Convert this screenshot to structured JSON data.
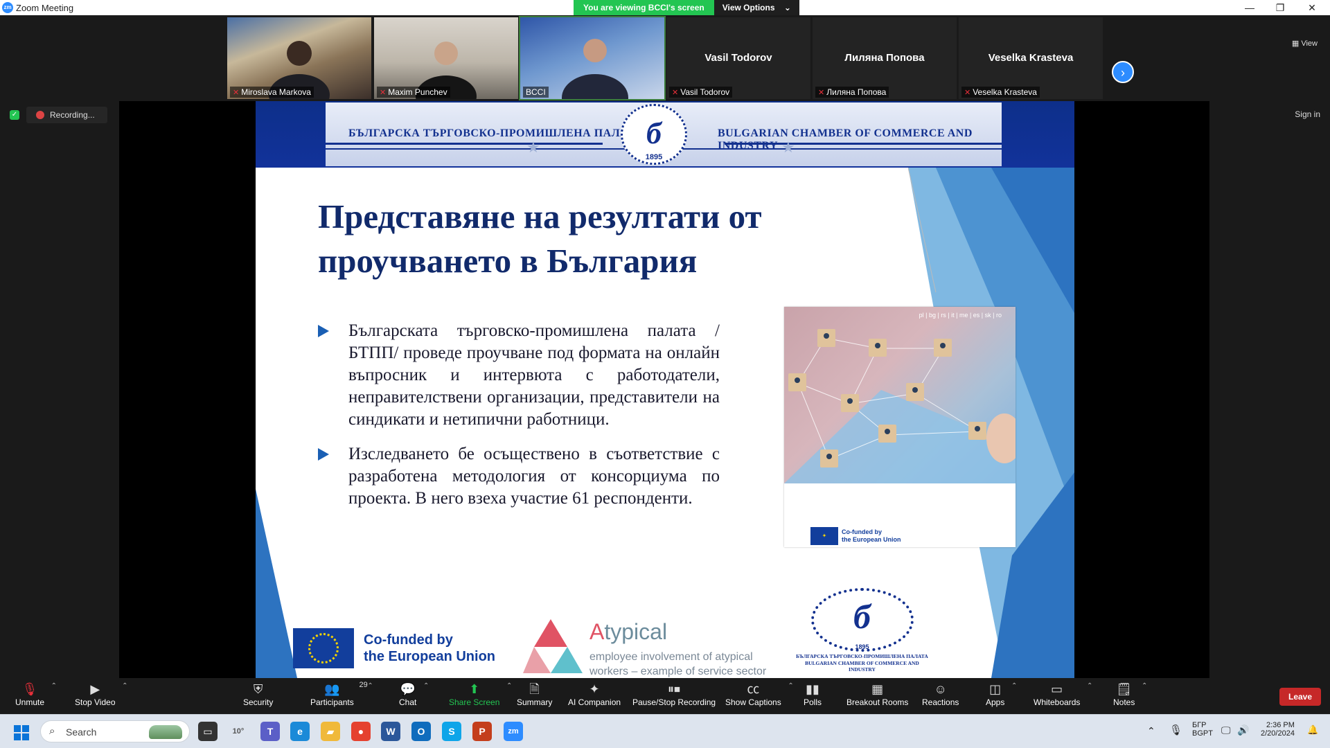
{
  "window": {
    "title": "Zoom Meeting",
    "logo_text": "zm",
    "minimize": "—",
    "maximize": "❐",
    "close": "✕"
  },
  "viewing_banner": {
    "text": "You are viewing BCCI's screen",
    "options_label": "View Options",
    "options_caret": "⌄"
  },
  "gallery": {
    "participants": [
      {
        "name": "Miroslava Markova",
        "has_video": true
      },
      {
        "name": "Maxim Punchev",
        "has_video": true
      },
      {
        "name": "BCCI",
        "has_video": true,
        "active": true
      },
      {
        "name": "Vasil Todorov",
        "has_video": false
      },
      {
        "name": "Лиляна Попова",
        "has_video": false
      },
      {
        "name": "Veselka Krasteva",
        "has_video": false
      }
    ],
    "next_arrow": "›",
    "view_label": "View"
  },
  "status": {
    "recording_label": "Recording...",
    "pause_glyph": "❚❚",
    "sign_in": "Sign in"
  },
  "slide": {
    "header_left": "БЪЛГАРСКА ТЪРГОВСКО-ПРОМИШЛЕНА ПАЛАТА",
    "header_right": "BULGARIAN CHAMBER OF COMMERCE AND INDUSTRY",
    "emblem_letter": "б",
    "emblem_year": "1895",
    "title": "Представяне на резултати от проучването в България",
    "bullets": [
      "Българската търговско-промишлена палата /БТПП/ проведе проучване под формата на онлайн въпросник и интервюта с работодатели, неправителствени организации, представители на синдикати и нетипични работници.",
      "Изследването бе осъществено в съответствие с разработена методология от консорциума по проекта. В него взеха участие 61 респонденти."
    ],
    "photo_langs": "pl | bg | rs | it | me | es | sk | ro",
    "photo_cofund_1": "Co-funded by",
    "photo_cofund_2": "the European Union",
    "footer_cofund_1": "Co-funded by",
    "footer_cofund_2": "the European Union",
    "atypical_A": "A",
    "atypical_rest": "typical",
    "atypical_sub_1": "employee involvement of atypical",
    "atypical_sub_2": "workers – example of service sector",
    "bcci_letter": "б",
    "bcci_year": "1895",
    "bcci_bg": "БЪЛГАРСКА ТЪРГОВСКО-ПРОМИШЛЕНА ПАЛАТА",
    "bcci_en": "BULGARIAN CHAMBER OF COMMERCE AND INDUSTRY"
  },
  "toolbar": {
    "unmute": "Unmute",
    "stop_video": "Stop Video",
    "security": "Security",
    "participants": "Participants",
    "participants_count": "29",
    "chat": "Chat",
    "share_screen": "Share Screen",
    "summary": "Summary",
    "ai_companion": "AI Companion",
    "pause_recording": "Pause/Stop Recording",
    "show_captions": "Show Captions",
    "polls": "Polls",
    "breakout_rooms": "Breakout Rooms",
    "reactions": "Reactions",
    "apps": "Apps",
    "whiteboards": "Whiteboards",
    "notes": "Notes",
    "leave": "Leave"
  },
  "taskbar": {
    "search_label": "Search",
    "weather": "10°",
    "lang_1": "БГР",
    "lang_2": "BGPT",
    "time": "2:36 PM",
    "date": "2/20/2024"
  }
}
